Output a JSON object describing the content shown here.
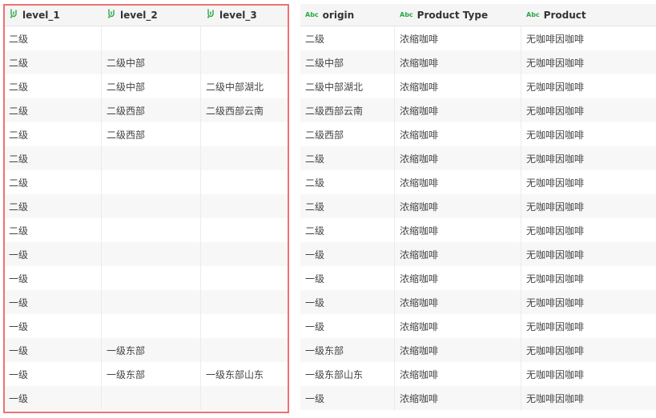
{
  "headers": {
    "level_1": "level_1",
    "level_2": "level_2",
    "level_3": "level_3",
    "origin": "origin",
    "product_type": "Product Type",
    "product": "Product",
    "abc_badge": "Abc"
  },
  "icons": {
    "hierarchy": "hierarchy-icon",
    "text_type": "abc-text-icon"
  },
  "colors": {
    "accent": "#2aa84a",
    "selection": "#f07070"
  },
  "rows": [
    {
      "level_1": "二级",
      "level_2": "",
      "level_3": "",
      "origin": "二级",
      "product_type": "浓缩咖啡",
      "product": "无咖啡因咖啡"
    },
    {
      "level_1": "二级",
      "level_2": "二级中部",
      "level_3": "",
      "origin": "二级中部",
      "product_type": "浓缩咖啡",
      "product": "无咖啡因咖啡"
    },
    {
      "level_1": "二级",
      "level_2": "二级中部",
      "level_3": "二级中部湖北",
      "origin": "二级中部湖北",
      "product_type": "浓缩咖啡",
      "product": "无咖啡因咖啡"
    },
    {
      "level_1": "二级",
      "level_2": "二级西部",
      "level_3": "二级西部云南",
      "origin": "二级西部云南",
      "product_type": "浓缩咖啡",
      "product": "无咖啡因咖啡"
    },
    {
      "level_1": "二级",
      "level_2": "二级西部",
      "level_3": "",
      "origin": "二级西部",
      "product_type": "浓缩咖啡",
      "product": "无咖啡因咖啡"
    },
    {
      "level_1": "二级",
      "level_2": "",
      "level_3": "",
      "origin": "二级",
      "product_type": "浓缩咖啡",
      "product": "无咖啡因咖啡"
    },
    {
      "level_1": "二级",
      "level_2": "",
      "level_3": "",
      "origin": "二级",
      "product_type": "浓缩咖啡",
      "product": "无咖啡因咖啡"
    },
    {
      "level_1": "二级",
      "level_2": "",
      "level_3": "",
      "origin": "二级",
      "product_type": "浓缩咖啡",
      "product": "无咖啡因咖啡"
    },
    {
      "level_1": "二级",
      "level_2": "",
      "level_3": "",
      "origin": "二级",
      "product_type": "浓缩咖啡",
      "product": "无咖啡因咖啡"
    },
    {
      "level_1": "一级",
      "level_2": "",
      "level_3": "",
      "origin": "一级",
      "product_type": "浓缩咖啡",
      "product": "无咖啡因咖啡"
    },
    {
      "level_1": "一级",
      "level_2": "",
      "level_3": "",
      "origin": "一级",
      "product_type": "浓缩咖啡",
      "product": "无咖啡因咖啡"
    },
    {
      "level_1": "一级",
      "level_2": "",
      "level_3": "",
      "origin": "一级",
      "product_type": "浓缩咖啡",
      "product": "无咖啡因咖啡"
    },
    {
      "level_1": "一级",
      "level_2": "",
      "level_3": "",
      "origin": "一级",
      "product_type": "浓缩咖啡",
      "product": "无咖啡因咖啡"
    },
    {
      "level_1": "一级",
      "level_2": "一级东部",
      "level_3": "",
      "origin": "一级东部",
      "product_type": "浓缩咖啡",
      "product": "无咖啡因咖啡"
    },
    {
      "level_1": "一级",
      "level_2": "一级东部",
      "level_3": "一级东部山东",
      "origin": "一级东部山东",
      "product_type": "浓缩咖啡",
      "product": "无咖啡因咖啡"
    },
    {
      "level_1": "一级",
      "level_2": "",
      "level_3": "",
      "origin": "一级",
      "product_type": "浓缩咖啡",
      "product": "无咖啡因咖啡"
    }
  ]
}
